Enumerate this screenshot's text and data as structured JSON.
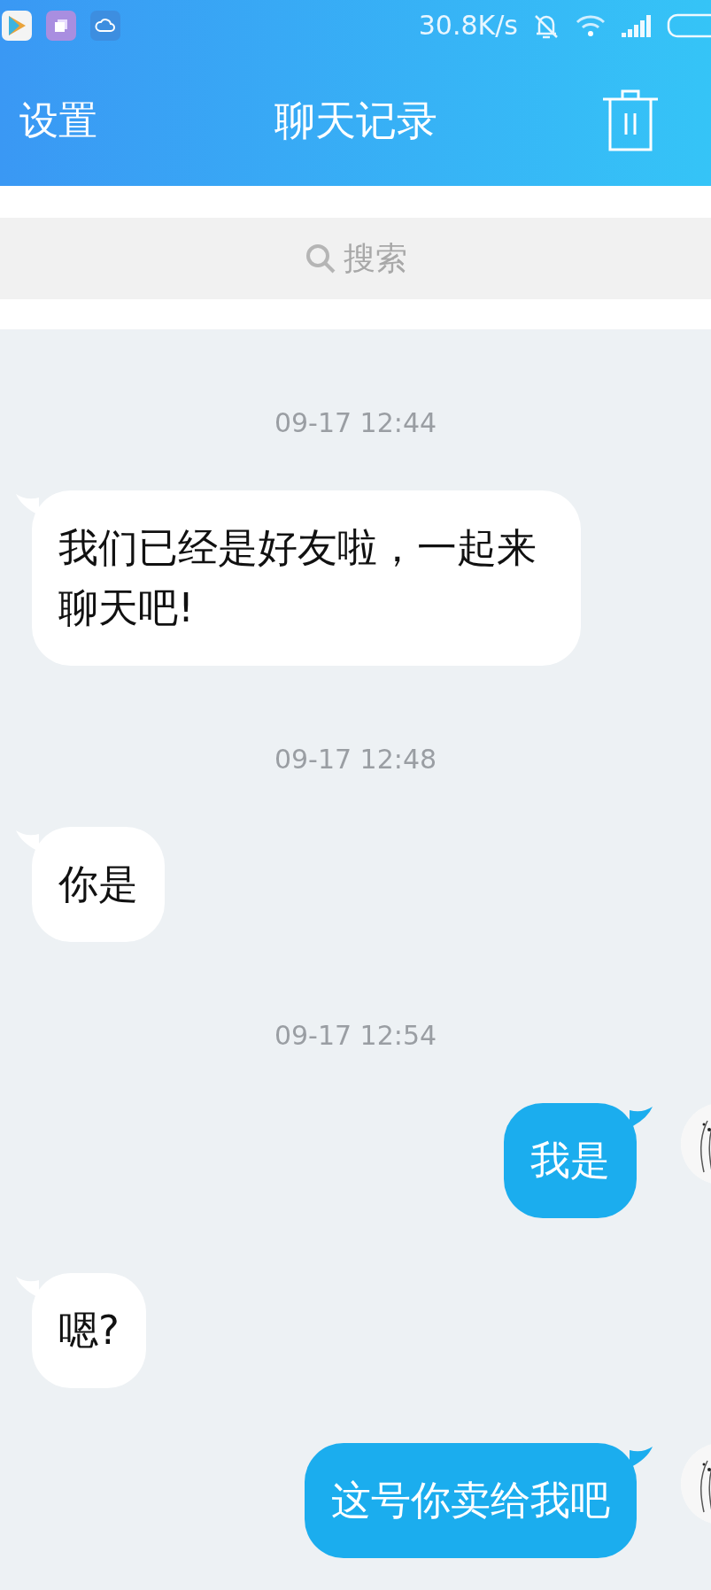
{
  "status_bar": {
    "speed": "30.8K/s"
  },
  "header": {
    "back_label": "设置",
    "title": "聊天记录"
  },
  "search": {
    "placeholder": "搜索"
  },
  "messages": [
    {
      "kind": "time",
      "text": "09-17 12:44"
    },
    {
      "kind": "incoming",
      "text": "我们已经是好友啦，一起来聊天吧!"
    },
    {
      "kind": "time",
      "text": "09-17 12:48"
    },
    {
      "kind": "incoming",
      "text": "你是"
    },
    {
      "kind": "time",
      "text": "09-17 12:54"
    },
    {
      "kind": "outgoing",
      "text": "我是"
    },
    {
      "kind": "incoming",
      "text": "嗯?"
    },
    {
      "kind": "outgoing",
      "text": "这号你卖给我吧"
    }
  ]
}
